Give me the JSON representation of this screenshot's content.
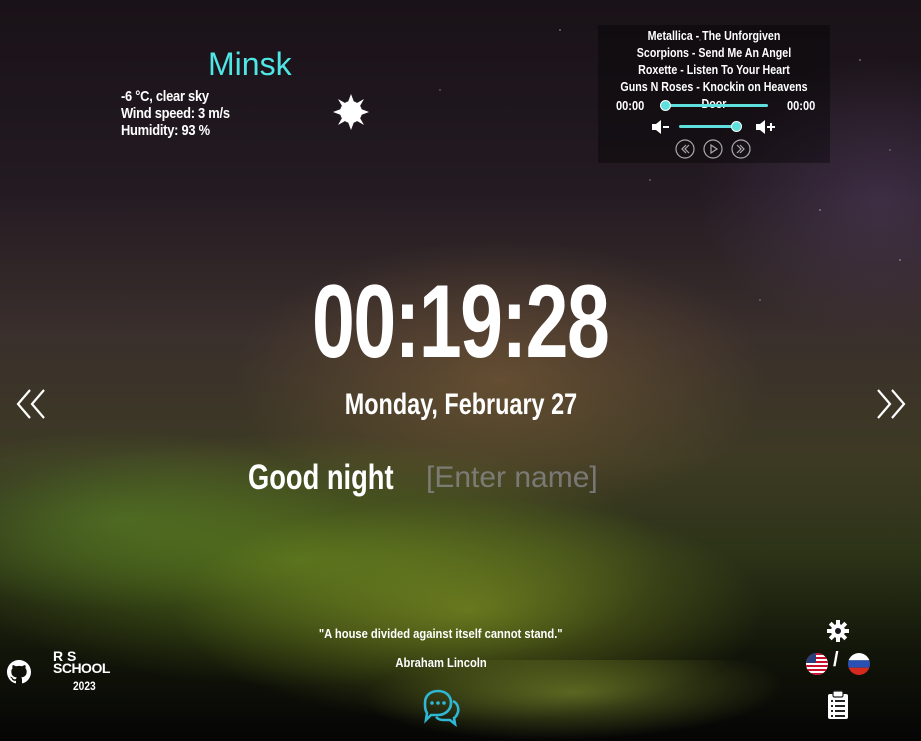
{
  "weather": {
    "city": "Minsk",
    "temp_desc": "-6 °C, clear sky",
    "wind": "Wind speed: 3 m/s",
    "humidity": "Humidity: 93 %",
    "icon": "clear-night-icon"
  },
  "player": {
    "playlist": [
      "Metallica - The Unforgiven",
      "Scorpions - Send Me An Angel",
      "Roxette - Listen To Your Heart",
      "Guns N Roses - Knockin on Heavens Door"
    ],
    "current_time": "00:00",
    "duration": "00:00",
    "progress": 0,
    "volume": 1.0,
    "accent": "#5fe0dc"
  },
  "clock": {
    "time": "00:19:28",
    "date": "Monday, February 27"
  },
  "greeting": {
    "text": "Good night",
    "name_placeholder": "[Enter name]"
  },
  "quote": {
    "text": "\"A house divided against itself cannot stand.\"",
    "author": "Abraham Lincoln"
  },
  "settings": {
    "lang_en": "🇺🇸",
    "lang_sep": "/",
    "lang_ru": "🇷🇺"
  },
  "footer": {
    "rs_line1": "R S",
    "rs_line2": "SCHOOL",
    "year": "2023"
  }
}
